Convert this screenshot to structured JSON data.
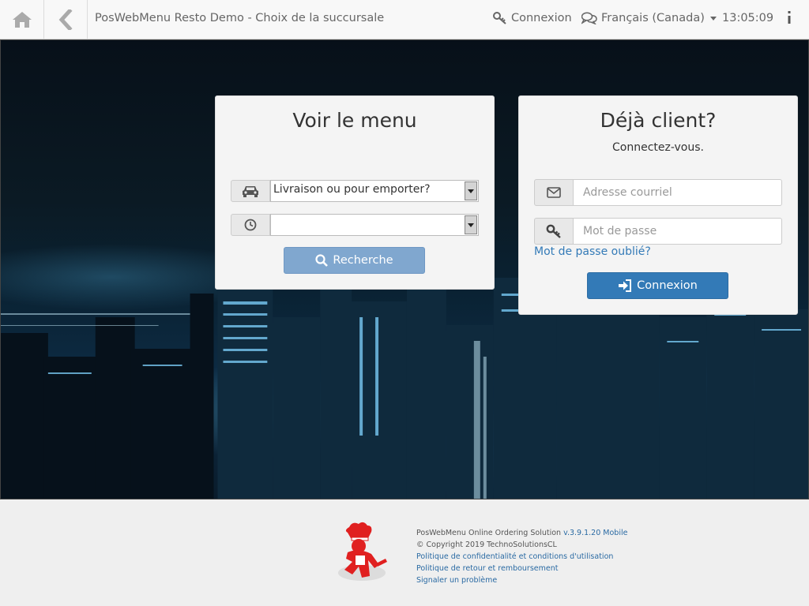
{
  "header": {
    "title": "PosWebMenu Resto Demo - Choix de la succursale",
    "login_label": "Connexion",
    "language_label": "Français (Canada)",
    "time": "13:05:09"
  },
  "menu_panel": {
    "title": "Voir le menu",
    "order_type_selected": "Livraison ou pour emporter?",
    "time_selected": "",
    "search_button": "Recherche"
  },
  "login_panel": {
    "title": "Déjà client?",
    "subtitle": "Connectez-vous.",
    "email_placeholder": "Adresse courriel",
    "password_placeholder": "Mot de passe",
    "forgot_link": "Mot de passe oublié?",
    "login_button": "Connexion"
  },
  "footer": {
    "product": "PosWebMenu Online Ordering Solution",
    "version": "v.3.9.1.20 Mobile",
    "copyright": "© Copyright 2019 TechnoSolutionsCL",
    "privacy_link": "Politique de confidentialité et conditions d'utilisation",
    "refund_link": "Politique de retour et remboursement",
    "report_link": "Signaler un problème"
  },
  "colors": {
    "primary": "#337ab7",
    "primary_disabled": "#80a7cf",
    "topbar_bg": "#f8f8f8",
    "panel_bg": "#f4f4f4",
    "logo_red": "#e02020"
  },
  "icons": [
    "home-icon",
    "back-arrow-icon",
    "key-icon",
    "chat-icon",
    "more-vertical-icon",
    "car-icon",
    "clock-icon",
    "search-icon",
    "envelope-icon",
    "sign-in-icon",
    "chef-logo"
  ]
}
